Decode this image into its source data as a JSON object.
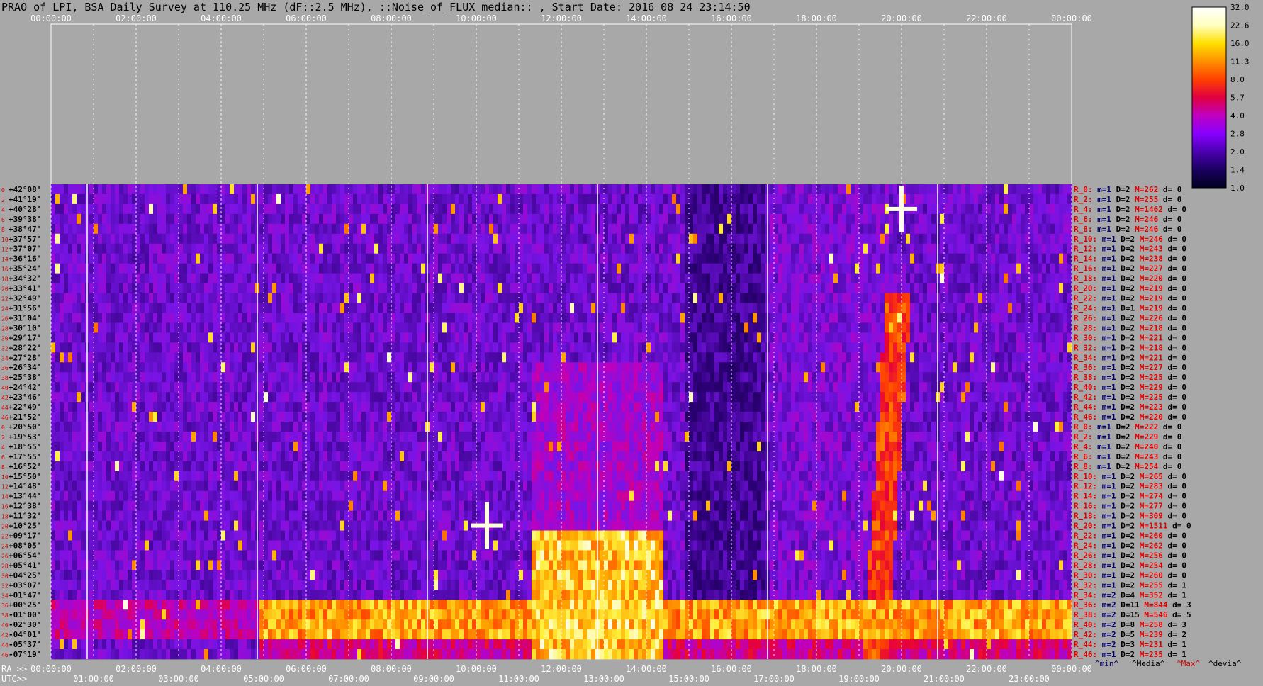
{
  "header": {
    "title": "PRAO of LPI, BSA Daily Survey at 110.25 MHz (dF::2.5 MHz), ::Noise_of_FLUX_median:: , Start Date: 2016 08 24 23:14:50"
  },
  "chart_data": {
    "type": "heatmap",
    "title": "PRAO of LPI, BSA Daily Survey at 110.25 MHz (dF::2.5 MHz), ::Noise_of_FLUX_median:: , Start Date: 2016 08 24 23:14:50",
    "top_axis_labels": [
      "00:00:00",
      "02:00:00",
      "04:00:00",
      "06:00:00",
      "08:00:00",
      "10:00:00",
      "12:00:00",
      "14:00:00",
      "16:00:00",
      "18:00:00",
      "20:00:00",
      "22:00:00",
      "00:00:00"
    ],
    "ra_label": "RA >>",
    "ra_ticks": [
      "00:00:00",
      "02:00:00",
      "04:00:00",
      "06:00:00",
      "08:00:00",
      "10:00:00",
      "12:00:00",
      "14:00:00",
      "16:00:00",
      "18:00:00",
      "20:00:00",
      "22:00:00",
      "00:00:00"
    ],
    "utc_label": "UTC>>",
    "utc_ticks": [
      "01:00:00",
      "03:00:00",
      "05:00:00",
      "07:00:00",
      "09:00:00",
      "11:00:00",
      "13:00:00",
      "15:00:00",
      "17:00:00",
      "19:00:00",
      "21:00:00",
      "23:00:00"
    ],
    "declinations": [
      "+42°08'",
      "+41°19'",
      "+40°28'",
      "+39°38'",
      "+38°47'",
      "+37°57'",
      "+37°07'",
      "+36°16'",
      "+35°24'",
      "+34°32'",
      "+33°41'",
      "+32°49'",
      "+31°56'",
      "+31°04'",
      "+30°10'",
      "+29°17'",
      "+28°22'",
      "+27°28'",
      "+26°34'",
      "+25°38'",
      "+24°42'",
      "+23°46'",
      "+22°49'",
      "+21°52'",
      "+20°50'",
      "+19°53'",
      "+18°55'",
      "+17°55'",
      "+16°52'",
      "+15°50'",
      "+14°48'",
      "+13°44'",
      "+12°38'",
      "+11°32'",
      "+10°25'",
      "+09°17'",
      "+08°05'",
      "+06°54'",
      "+05°41'",
      "+04°25'",
      "+03°07'",
      "+01°47'",
      "+00°25'",
      "-01°00'",
      "-02°30'",
      "-04°01'",
      "-05°37'",
      "-07°19'"
    ],
    "row_index_labels": [
      "0",
      "2",
      "4",
      "6",
      "8",
      "10",
      "12",
      "14",
      "16",
      "18",
      "20",
      "22",
      "24",
      "26",
      "28",
      "30",
      "32",
      "34",
      "36",
      "38",
      "40",
      "42",
      "44",
      "46",
      "0",
      "2",
      "4",
      "6",
      "8",
      "10",
      "12",
      "14",
      "16",
      "18",
      "20",
      "22",
      "24",
      "26",
      "28",
      "30",
      "32",
      "34",
      "36",
      "38",
      "40",
      "42",
      "44",
      "46"
    ],
    "stats": [
      {
        "r": "R_0:",
        "m": "m=1",
        "d": "D=2",
        "mx": "M=262",
        "dev": "d= 0"
      },
      {
        "r": "R_2:",
        "m": "m=1",
        "d": "D=2",
        "mx": "M=255",
        "dev": "d= 0"
      },
      {
        "r": "R_4:",
        "m": "m=1",
        "d": "D=2",
        "mx": "M=1462",
        "dev": "d= 0"
      },
      {
        "r": "R_6:",
        "m": "m=1",
        "d": "D=2",
        "mx": "M=246",
        "dev": "d= 0"
      },
      {
        "r": "R_8:",
        "m": "m=1",
        "d": "D=2",
        "mx": "M=246",
        "dev": "d= 0"
      },
      {
        "r": "R_10:",
        "m": "m=1",
        "d": "D=2",
        "mx": "M=246",
        "dev": "d= 0"
      },
      {
        "r": "R_12:",
        "m": "m=1",
        "d": "D=2",
        "mx": "M=243",
        "dev": "d= 0"
      },
      {
        "r": "R_14:",
        "m": "m=1",
        "d": "D=2",
        "mx": "M=238",
        "dev": "d= 0"
      },
      {
        "r": "R_16:",
        "m": "m=1",
        "d": "D=2",
        "mx": "M=227",
        "dev": "d= 0"
      },
      {
        "r": "R_18:",
        "m": "m=1",
        "d": "D=2",
        "mx": "M=220",
        "dev": "d= 0"
      },
      {
        "r": "R_20:",
        "m": "m=1",
        "d": "D=2",
        "mx": "M=219",
        "dev": "d= 0"
      },
      {
        "r": "R_22:",
        "m": "m=1",
        "d": "D=2",
        "mx": "M=219",
        "dev": "d= 0"
      },
      {
        "r": "R_24:",
        "m": "m=1",
        "d": "D=1",
        "mx": "M=219",
        "dev": "d= 0"
      },
      {
        "r": "R_26:",
        "m": "m=1",
        "d": "D=2",
        "mx": "M=226",
        "dev": "d= 0"
      },
      {
        "r": "R_28:",
        "m": "m=1",
        "d": "D=2",
        "mx": "M=218",
        "dev": "d= 0"
      },
      {
        "r": "R_30:",
        "m": "m=1",
        "d": "D=2",
        "mx": "M=221",
        "dev": "d= 0"
      },
      {
        "r": "R_32:",
        "m": "m=1",
        "d": "D=2",
        "mx": "M=218",
        "dev": "d= 0"
      },
      {
        "r": "R_34:",
        "m": "m=1",
        "d": "D=2",
        "mx": "M=221",
        "dev": "d= 0"
      },
      {
        "r": "R_36:",
        "m": "m=1",
        "d": "D=2",
        "mx": "M=227",
        "dev": "d= 0"
      },
      {
        "r": "R_38:",
        "m": "m=1",
        "d": "D=2",
        "mx": "M=225",
        "dev": "d= 0"
      },
      {
        "r": "R_40:",
        "m": "m=1",
        "d": "D=2",
        "mx": "M=229",
        "dev": "d= 0"
      },
      {
        "r": "R_42:",
        "m": "m=1",
        "d": "D=2",
        "mx": "M=225",
        "dev": "d= 0"
      },
      {
        "r": "R_44:",
        "m": "m=1",
        "d": "D=2",
        "mx": "M=223",
        "dev": "d= 0"
      },
      {
        "r": "R_46:",
        "m": "m=1",
        "d": "D=2",
        "mx": "M=220",
        "dev": "d= 0"
      },
      {
        "r": "R_0:",
        "m": "m=1",
        "d": "D=2",
        "mx": "M=222",
        "dev": "d= 0"
      },
      {
        "r": "R_2:",
        "m": "m=1",
        "d": "D=2",
        "mx": "M=229",
        "dev": "d= 0"
      },
      {
        "r": "R_4:",
        "m": "m=1",
        "d": "D=2",
        "mx": "M=240",
        "dev": "d= 0"
      },
      {
        "r": "R_6:",
        "m": "m=1",
        "d": "D=2",
        "mx": "M=243",
        "dev": "d= 0"
      },
      {
        "r": "R_8:",
        "m": "m=1",
        "d": "D=2",
        "mx": "M=254",
        "dev": "d= 0"
      },
      {
        "r": "R_10:",
        "m": "m=1",
        "d": "D=2",
        "mx": "M=265",
        "dev": "d= 0"
      },
      {
        "r": "R_12:",
        "m": "m=1",
        "d": "D=2",
        "mx": "M=283",
        "dev": "d= 0"
      },
      {
        "r": "R_14:",
        "m": "m=1",
        "d": "D=2",
        "mx": "M=274",
        "dev": "d= 0"
      },
      {
        "r": "R_16:",
        "m": "m=1",
        "d": "D=2",
        "mx": "M=277",
        "dev": "d= 0"
      },
      {
        "r": "R_18:",
        "m": "m=1",
        "d": "D=2",
        "mx": "M=309",
        "dev": "d= 0"
      },
      {
        "r": "R_20:",
        "m": "m=1",
        "d": "D=2",
        "mx": "M=1511",
        "dev": "d= 0"
      },
      {
        "r": "R_22:",
        "m": "m=1",
        "d": "D=2",
        "mx": "M=260",
        "dev": "d= 0"
      },
      {
        "r": "R_24:",
        "m": "m=1",
        "d": "D=2",
        "mx": "M=262",
        "dev": "d= 0"
      },
      {
        "r": "R_26:",
        "m": "m=1",
        "d": "D=2",
        "mx": "M=256",
        "dev": "d= 0"
      },
      {
        "r": "R_28:",
        "m": "m=1",
        "d": "D=2",
        "mx": "M=254",
        "dev": "d= 0"
      },
      {
        "r": "R_30:",
        "m": "m=1",
        "d": "D=2",
        "mx": "M=260",
        "dev": "d= 0"
      },
      {
        "r": "R_32:",
        "m": "m=1",
        "d": "D=2",
        "mx": "M=255",
        "dev": "d= 1"
      },
      {
        "r": "R_34:",
        "m": "m=2",
        "d": "D=4",
        "mx": "M=352",
        "dev": "d= 1"
      },
      {
        "r": "R_36:",
        "m": "m=2",
        "d": "D=11",
        "mx": "M=844",
        "dev": "d= 3"
      },
      {
        "r": "R_38:",
        "m": "m=2",
        "d": "D=15",
        "mx": "M=546",
        "dev": "d= 5"
      },
      {
        "r": "R_40:",
        "m": "m=2",
        "d": "D=8",
        "mx": "M=258",
        "dev": "d= 3"
      },
      {
        "r": "R_42:",
        "m": "m=2",
        "d": "D=5",
        "mx": "M=239",
        "dev": "d= 2"
      },
      {
        "r": "R_44:",
        "m": "m=2",
        "d": "D=3",
        "mx": "M=231",
        "dev": "d= 1"
      },
      {
        "r": "R_46:",
        "m": "m=1",
        "d": "D=2",
        "mx": "M=235",
        "dev": "d= 1"
      }
    ],
    "legend_footer": [
      "^min^",
      "^Media^",
      "^Max^",
      "^devia^"
    ],
    "colorbar": {
      "ticks": [
        "32.0",
        "22.6",
        "16.0",
        "11.3",
        "8.0",
        "5.7",
        "4.0",
        "2.8",
        "2.0",
        "1.4",
        "1.0"
      ],
      "colors": [
        "#000020",
        "#1a0060",
        "#4a00b0",
        "#8800ff",
        "#c000c0",
        "#e00040",
        "#ff4000",
        "#ff9000",
        "#ffe000",
        "#ffffc0",
        "#ffffff"
      ]
    },
    "colors": {
      "background": "#a8a8a8",
      "stats_dark": "#00006e",
      "stats_red": "#e00000",
      "index_red": "#d00000"
    }
  }
}
